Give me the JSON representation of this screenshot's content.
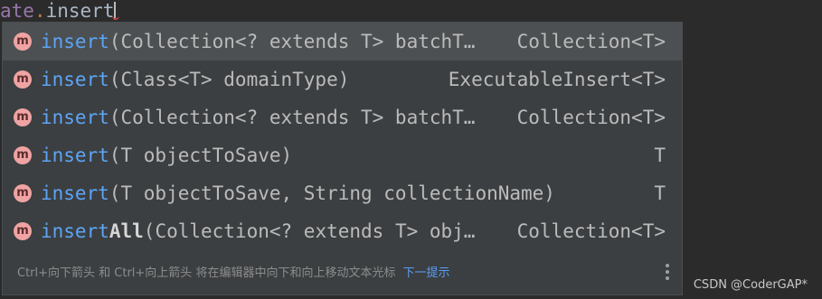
{
  "editor": {
    "text_object": "ate",
    "text_dot": ".",
    "text_method": "insert"
  },
  "completion": {
    "items": [
      {
        "icon": "m",
        "name": "insert",
        "name_extra": "",
        "params": "(Collection<? extends T> batchT…",
        "return_type": "Collection<T>",
        "selected": true
      },
      {
        "icon": "m",
        "name": "insert",
        "name_extra": "",
        "params": "(Class<T> domainType)",
        "return_type": "ExecutableInsert<T>",
        "selected": false
      },
      {
        "icon": "m",
        "name": "insert",
        "name_extra": "",
        "params": "(Collection<? extends T> batchT…",
        "return_type": "Collection<T>",
        "selected": false
      },
      {
        "icon": "m",
        "name": "insert",
        "name_extra": "",
        "params": "(T objectToSave)",
        "return_type": "T",
        "selected": false
      },
      {
        "icon": "m",
        "name": "insert",
        "name_extra": "",
        "params": "(T objectToSave, String collectionName)",
        "return_type": "T",
        "selected": false
      },
      {
        "icon": "m",
        "name": "insert",
        "name_extra": "All",
        "params": "(Collection<? extends T> obj…",
        "return_type": "Collection<T>",
        "selected": false
      }
    ],
    "footer_hint": "Ctrl+向下箭头 和 Ctrl+向上箭头 将在编辑器中向下和向上移动文本光标",
    "footer_link": "下一提示"
  },
  "watermark": "CSDN @CoderGAP*",
  "colors": {
    "background": "#2b2b2b",
    "popup": "#3c3f41",
    "selected_row": "#4c5052",
    "method_name": "#5da4f5",
    "method_icon": "#f0a3a3",
    "link": "#589df6"
  }
}
